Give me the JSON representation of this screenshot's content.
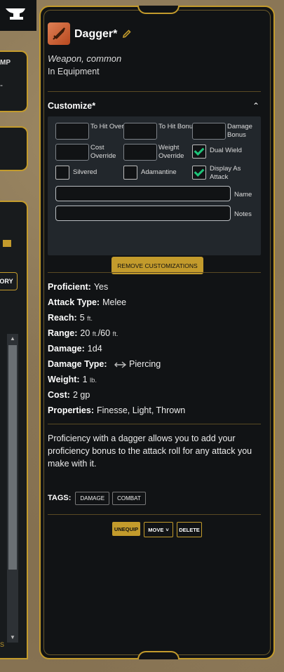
{
  "background_panels": {
    "mp_label": "MP",
    "mp_dash": "-",
    "history_btn": "ORY",
    "scroll_s": "S"
  },
  "item": {
    "name": "Dagger*",
    "subtype": "Weapon, common",
    "location": "In Equipment",
    "icon": "dagger-icon"
  },
  "customize": {
    "title": "Customize*",
    "fields": {
      "to_hit_override": "To Hit Override",
      "to_hit_bonus": "To Hit Bonus",
      "damage_bonus": "Damage Bonus",
      "cost_override": "Cost Override",
      "weight_override": "Weight Override",
      "dual_wield": "Dual Wield",
      "silvered": "Silvered",
      "adamantine": "Adamantine",
      "display_as_attack": "Display As Attack",
      "name": "Name",
      "notes": "Notes"
    },
    "checks": {
      "dual_wield": true,
      "silvered": false,
      "adamantine": false,
      "display_as_attack": true
    },
    "remove_button": "REMOVE CUSTOMIZATIONS"
  },
  "properties": {
    "proficient_label": "Proficient:",
    "proficient": "Yes",
    "attack_type_label": "Attack Type:",
    "attack_type": "Melee",
    "reach_label": "Reach:",
    "reach": "5",
    "reach_unit": "ft.",
    "range_label": "Range:",
    "range_short": "20",
    "range_short_unit": "ft.",
    "range_sep": "/",
    "range_long": "60",
    "range_long_unit": "ft.",
    "damage_label": "Damage:",
    "damage": "1d4",
    "damage_type_label": "Damage Type:",
    "damage_type": "Piercing",
    "weight_label": "Weight:",
    "weight": "1",
    "weight_unit": "lb.",
    "cost_label": "Cost:",
    "cost": "2 gp",
    "properties_label": "Properties:",
    "properties": "Finesse, Light, Thrown"
  },
  "description": "Proficiency with a dagger allows you to add your proficiency bonus to the attack roll for any attack you make with it.",
  "tags": {
    "label": "TAGS:",
    "items": [
      "DAMAGE",
      "COMBAT"
    ]
  },
  "actions": {
    "unequip": "UNEQUIP",
    "move": "MOVE",
    "delete": "DELETE"
  },
  "colors": {
    "accent": "#c39b2c",
    "panel": "#111315",
    "check": "#1ec47a"
  }
}
